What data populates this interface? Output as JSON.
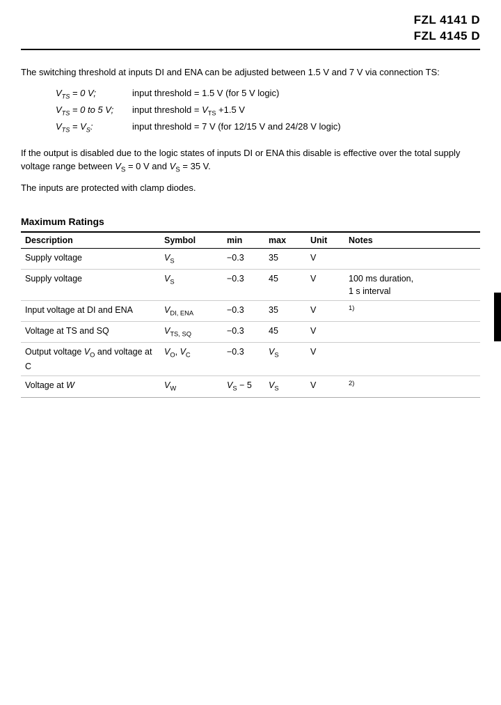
{
  "header": {
    "line1": "FZL 4141 D",
    "line2": "FZL 4145 D"
  },
  "intro": {
    "paragraph": "The switching threshold at inputs DI and ENA can be adjusted between 1.5 V and 7 V via connection TS:"
  },
  "thresholds": [
    {
      "var": "V_TS = 0 V;",
      "desc": "input threshold = 1.5 V (for 5 V logic)"
    },
    {
      "var": "V_TS = 0 to 5 V;",
      "desc": "input threshold = V_TS +1.5 V"
    },
    {
      "var": "V_TS = V_S:",
      "desc": "input threshold = 7 V (for 12/15 V and 24/28 V logic)"
    }
  ],
  "disabled_text": "If the output is disabled due to the logic states of inputs DI or ENA this disable is effective over the total supply voltage range between V_S = 0 V and V_S = 35 V.",
  "clamp_text": "The inputs are protected with clamp diodes.",
  "max_ratings": {
    "title": "Maximum Ratings",
    "columns": [
      "Description",
      "Symbol",
      "min",
      "max",
      "Unit",
      "Notes"
    ],
    "rows": [
      {
        "desc": "Supply voltage",
        "symbol": "V_S",
        "min": "−0.3",
        "max": "35",
        "unit": "V",
        "notes": ""
      },
      {
        "desc": "Supply voltage",
        "symbol": "V_S",
        "min": "−0.3",
        "max": "45",
        "unit": "V",
        "notes": "100 ms duration,\n1 s interval"
      },
      {
        "desc": "Input voltage at DI and ENA",
        "symbol": "V_DI_ENA",
        "min": "−0.3",
        "max": "35",
        "unit": "V",
        "notes": "1)"
      },
      {
        "desc": "Voltage at TS and SQ",
        "symbol": "V_TS_SQ",
        "min": "−0.3",
        "max": "45",
        "unit": "V",
        "notes": ""
      },
      {
        "desc": "Output voltage V_O and voltage at C",
        "symbol": "V_O_VC",
        "min": "−0.3",
        "max": "V_S",
        "unit": "V",
        "notes": ""
      },
      {
        "desc": "Voltage at W",
        "symbol": "V_W",
        "min": "V_S − 5",
        "max": "V_S",
        "unit": "V",
        "notes": "2)"
      }
    ]
  }
}
